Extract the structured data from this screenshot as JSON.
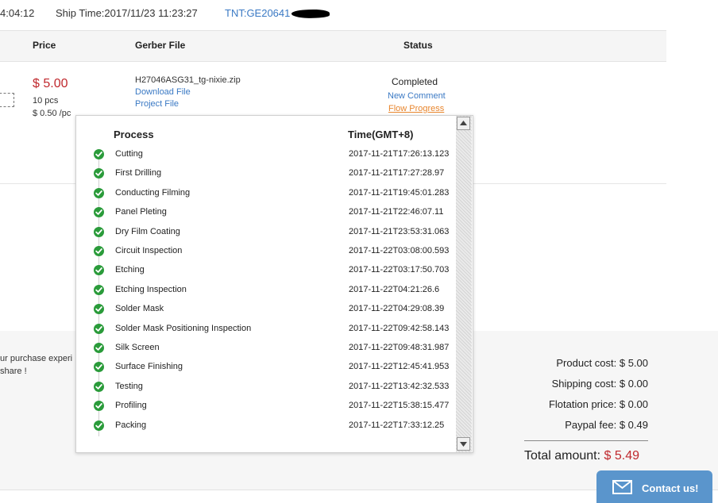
{
  "top": {
    "time_fragment": "4:04:12",
    "ship_time": "Ship Time:2017/11/23 11:23:27",
    "tnt": "TNT:GE20641"
  },
  "table": {
    "headers": {
      "price": "Price",
      "gerber": "Gerber File",
      "status": "Status"
    },
    "row": {
      "price": "$ 5.00",
      "qty": "10 pcs",
      "unit": "$ 0.50 /pc",
      "file": "H27046ASG31_tg-nixie.zip",
      "download": "Download File",
      "project": "Project File",
      "status": "Completed",
      "new_comment": "New Comment",
      "flow_progress": "Flow Progress"
    }
  },
  "popup": {
    "col_process": "Process",
    "col_time": "Time(GMT+8)",
    "steps": [
      {
        "name": "Cutting",
        "time": "2017-11-21T17:26:13.123"
      },
      {
        "name": "First Drilling",
        "time": "2017-11-21T17:27:28.97"
      },
      {
        "name": "Conducting Filming",
        "time": "2017-11-21T19:45:01.283"
      },
      {
        "name": "Panel Pleting",
        "time": "2017-11-21T22:46:07.11"
      },
      {
        "name": "Dry Film Coating",
        "time": "2017-11-21T23:53:31.063"
      },
      {
        "name": "Circuit Inspection",
        "time": "2017-11-22T03:08:00.593"
      },
      {
        "name": "Etching",
        "time": "2017-11-22T03:17:50.703"
      },
      {
        "name": "Etching Inspection",
        "time": "2017-11-22T04:21:26.6"
      },
      {
        "name": "Solder Mask",
        "time": "2017-11-22T04:29:08.39"
      },
      {
        "name": "Solder Mask Positioning Inspection",
        "time": "2017-11-22T09:42:58.143"
      },
      {
        "name": "Silk Screen",
        "time": "2017-11-22T09:48:31.987"
      },
      {
        "name": "Surface Finishing",
        "time": "2017-11-22T12:45:41.953"
      },
      {
        "name": "Testing",
        "time": "2017-11-22T13:42:32.533"
      },
      {
        "name": "Profiling",
        "time": "2017-11-22T15:38:15.477"
      },
      {
        "name": "Packing",
        "time": "2017-11-22T17:33:12.25"
      }
    ]
  },
  "footer": {
    "text_line1": "ur purchase experi",
    "text_line2": "share !",
    "product_cost": "Product cost: $ 5.00",
    "shipping_cost": "Shipping cost: $ 0.00",
    "flotation_price": "Flotation price: $ 0.00",
    "paypal_fee": "Paypal fee: $ 0.49",
    "total_label": "Total amount:",
    "total_value": "$ 5.49",
    "contact": "Contact us!"
  },
  "colors": {
    "accent_red": "#c0282d",
    "link_blue": "#3a79c4",
    "link_orange": "#e8862e",
    "check_green": "#2a9b3a",
    "contact_bg": "#5a95cc"
  },
  "icons": {
    "step": "check-circle-icon",
    "contact": "envelope-icon",
    "scroll_up": "arrow-up-icon",
    "scroll_down": "arrow-down-icon"
  }
}
